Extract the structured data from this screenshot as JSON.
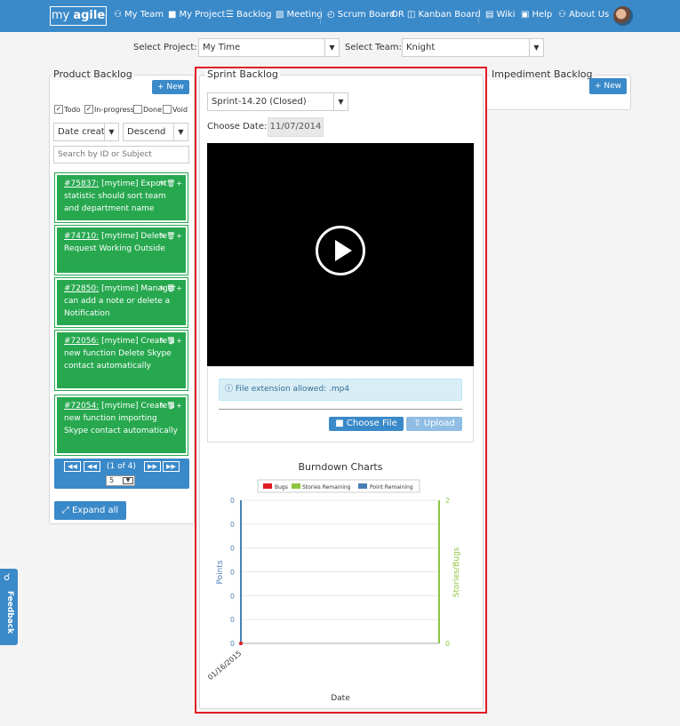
{
  "nav": {
    "logo_a": "my",
    "logo_b": "agile",
    "items": [
      "My Team",
      "My Project",
      "Backlog",
      "Meeting",
      "Scrum Board",
      "OR",
      "Kanban Board",
      "Wiki",
      "Help",
      "About Us"
    ]
  },
  "filters": {
    "project_label": "Select Project:",
    "project_value": "My Time",
    "team_label": "Select Team:",
    "team_value": "Knight"
  },
  "product_backlog": {
    "title": "Product Backlog",
    "new_label": "New",
    "checks": [
      {
        "label": "Todo",
        "checked": true
      },
      {
        "label": "In-progress",
        "checked": true
      },
      {
        "label": "Done",
        "checked": false
      },
      {
        "label": "Void",
        "checked": false
      }
    ],
    "sort_field": "Date creat",
    "sort_order": "Descend",
    "search_placeholder": "Search by ID or Subject",
    "cards": [
      {
        "id": "#75837:",
        "text": "[mytime] Export statistic should sort team and department name"
      },
      {
        "id": "#74710:",
        "text": "[mytime] Delete Request Working Outside"
      },
      {
        "id": "#72850:",
        "text": "[mytime] Manager can add a note or delete a Notification"
      },
      {
        "id": "#72056:",
        "text": "[mytime] Create a new function Delete Skype contact automatically"
      },
      {
        "id": "#72054:",
        "text": "[mytime] Create a new function importing Skype contact automatically"
      }
    ],
    "pager_text": "(1 of 4)",
    "page_size": "5",
    "expand_label": "Expand all"
  },
  "sprint_backlog": {
    "title": "Sprint Backlog",
    "sprint_value": "Sprint-14.20 (Closed)",
    "date_label": "Choose Date:",
    "date_value": "11/07/2014",
    "file_note": "File extension allowed: .mp4",
    "choose_label": "Choose File",
    "upload_label": "Upload"
  },
  "impediment_backlog": {
    "title": "Impediment Backlog",
    "new_label": "New"
  },
  "feedback_label": "Feedback",
  "colors": {
    "accent": "#3a89c9",
    "card": "#27a84f",
    "highlight": "#e01b24"
  },
  "chart_data": {
    "type": "line",
    "title": "Burndown Charts",
    "legend": [
      "Bugs",
      "Stories Remaining",
      "Point Remaining"
    ],
    "legend_colors": [
      "#e01b24",
      "#8dc63f",
      "#4a7fb5"
    ],
    "ylabel": "Points",
    "y2label": "Stories/Bugs",
    "xlabel": "Date",
    "categories": [
      "01/16/2015"
    ],
    "y_ticks": [
      "0",
      "0",
      "0",
      "0",
      "0",
      "0",
      "0"
    ],
    "y2_ticks": [
      "2",
      "0"
    ],
    "series": [
      {
        "name": "Point Remaining",
        "values": [
          0
        ]
      },
      {
        "name": "Stories Remaining",
        "values": [
          0
        ]
      },
      {
        "name": "Bugs",
        "values": [
          0
        ]
      }
    ],
    "legend_position": "top"
  }
}
